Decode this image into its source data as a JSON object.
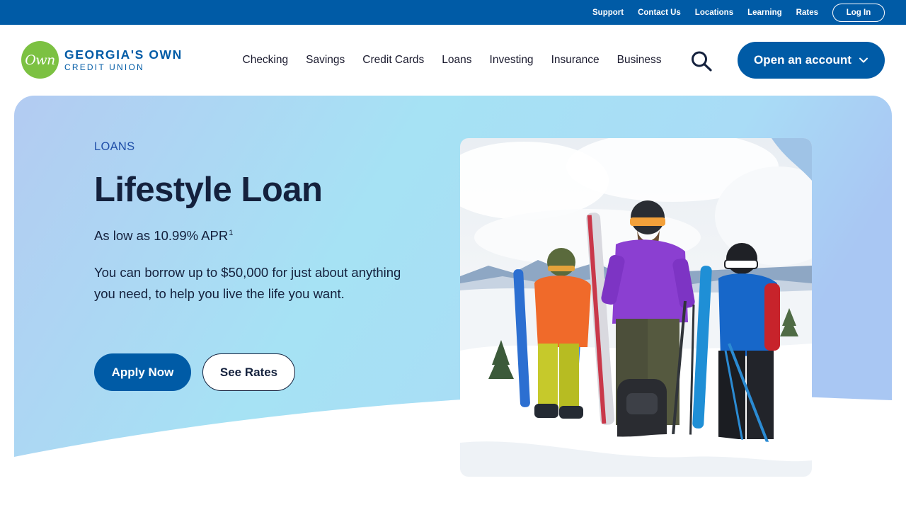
{
  "utility_nav": {
    "links": [
      "Support",
      "Contact Us",
      "Locations",
      "Learning",
      "Rates"
    ],
    "login_label": "Log In"
  },
  "brand": {
    "mark": "Own",
    "name_line1": "GEORGIA'S OWN",
    "name_line2": "CREDIT UNION",
    "mark_color": "#7cc142",
    "brand_color": "#005ba6"
  },
  "main_nav": {
    "items": [
      "Checking",
      "Savings",
      "Credit Cards",
      "Loans",
      "Investing",
      "Insurance",
      "Business"
    ],
    "search_icon": "search-icon",
    "cta_label": "Open an account"
  },
  "hero": {
    "eyebrow": "LOANS",
    "title": "Lifestyle Loan",
    "apr_text": "As low as 10.99% APR",
    "apr_footnote": "1",
    "description": "You can borrow up to $50,000 for just about anything you need, to help you live the life you want.",
    "primary_button": "Apply Now",
    "secondary_button": "See Rates"
  }
}
